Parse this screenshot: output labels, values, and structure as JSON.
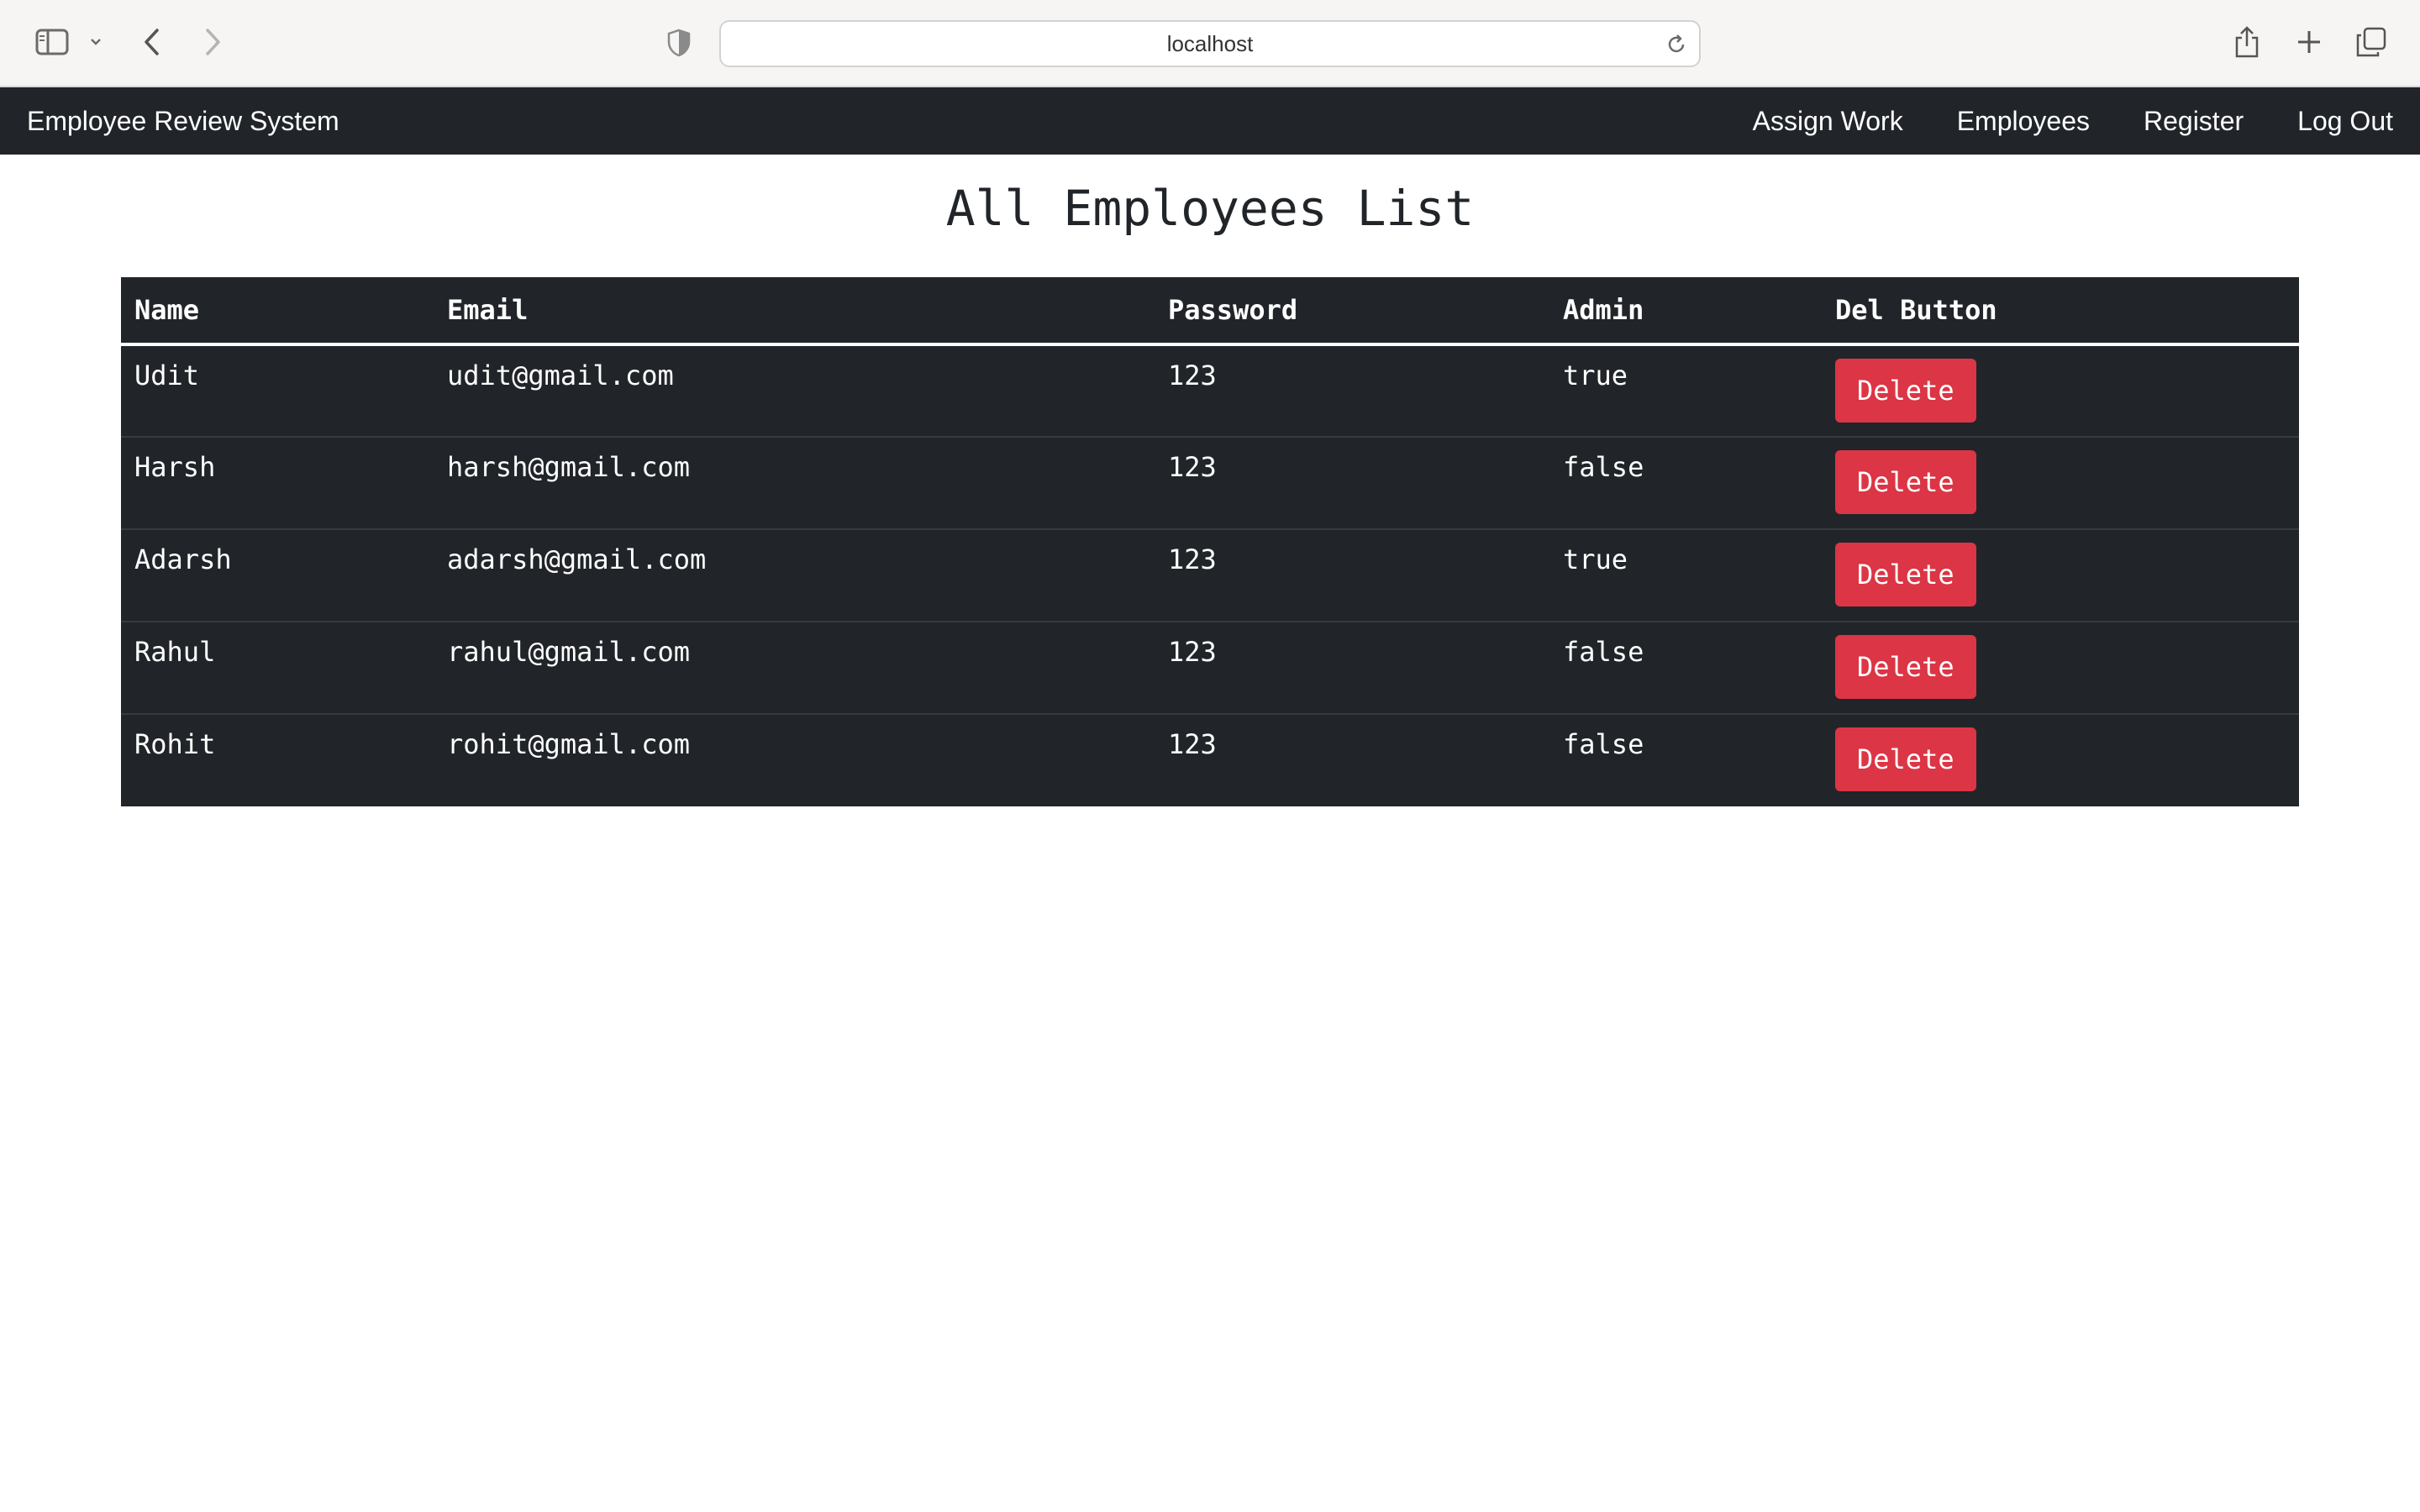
{
  "browser": {
    "url": "localhost"
  },
  "navbar": {
    "brand": "Employee Review System",
    "links": [
      "Assign Work",
      "Employees",
      "Register",
      "Log Out"
    ]
  },
  "main": {
    "title": "All Employees List",
    "table": {
      "headers": [
        "Name",
        "Email",
        "Password",
        "Admin",
        "Del Button"
      ],
      "rows": [
        {
          "name": "Udit",
          "email": "udit@gmail.com",
          "password": "123",
          "admin": "true",
          "button": "Delete"
        },
        {
          "name": "Harsh",
          "email": "harsh@gmail.com",
          "password": "123",
          "admin": "false",
          "button": "Delete"
        },
        {
          "name": "Adarsh",
          "email": "adarsh@gmail.com",
          "password": "123",
          "admin": "true",
          "button": "Delete"
        },
        {
          "name": "Rahul",
          "email": "rahul@gmail.com",
          "password": "123",
          "admin": "false",
          "button": "Delete"
        },
        {
          "name": "Rohit",
          "email": "rohit@gmail.com",
          "password": "123",
          "admin": "false",
          "button": "Delete"
        }
      ]
    }
  },
  "colors": {
    "navbar_bg": "#212529",
    "table_bg": "#212529",
    "delete_button": "#dc3545",
    "chrome_bg": "#f6f5f4"
  },
  "icons": {
    "sidebar_toggle": "sidebar-icon",
    "sidebar_menu": "chevron-down-icon",
    "back": "chevron-left-icon",
    "forward": "chevron-right-icon",
    "privacy": "shield-icon",
    "reload": "reload-icon",
    "share": "share-icon",
    "new_tab": "plus-icon",
    "tab_overview": "tabs-icon"
  }
}
